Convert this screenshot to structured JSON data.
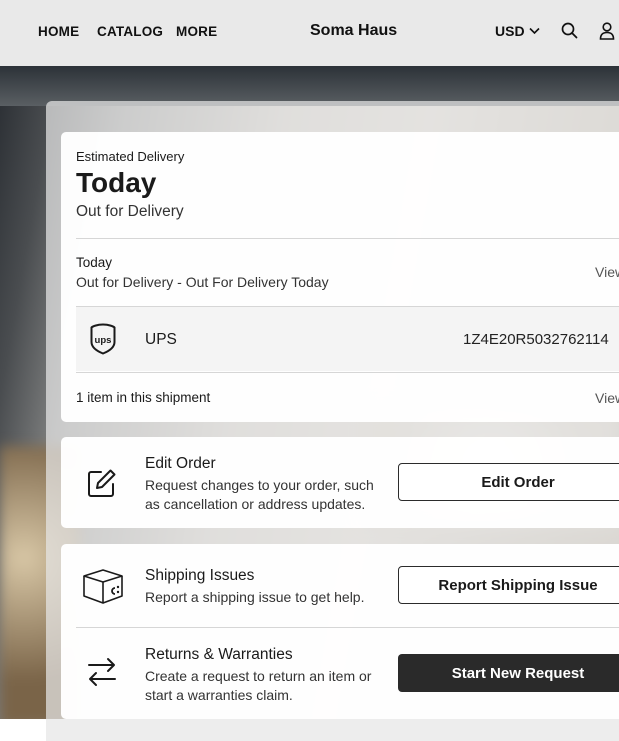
{
  "header": {
    "nav": [
      "HOME",
      "CATALOG",
      "MORE"
    ],
    "brand": "Soma Haus",
    "currency": "USD"
  },
  "delivery": {
    "label": "Estimated Delivery",
    "day": "Today",
    "status": "Out for Delivery"
  },
  "update": {
    "date": "Today",
    "text": "Out for Delivery - Out For Delivery Today",
    "link": "View"
  },
  "carrier": {
    "name": "UPS",
    "tracking": "1Z4E20R5032762114"
  },
  "shipment": {
    "count": "1 item in this shipment",
    "link": "View"
  },
  "actions": {
    "edit": {
      "title": "Edit Order",
      "desc1": "Request changes to your order, such",
      "desc2": "as cancellation or address updates.",
      "button": "Edit Order"
    },
    "shipping": {
      "title": "Shipping Issues",
      "desc": "Report a shipping issue to get help.",
      "button": "Report Shipping Issue"
    },
    "returns": {
      "title": "Returns & Warranties",
      "desc1": "Create a request to return an item or",
      "desc2": "start a warranties claim.",
      "button": "Start New Request"
    }
  },
  "icons": [
    "chevron-down-icon",
    "search-icon",
    "account-icon",
    "ups-logo-icon",
    "edit-icon",
    "package-icon",
    "swap-arrows-icon"
  ]
}
